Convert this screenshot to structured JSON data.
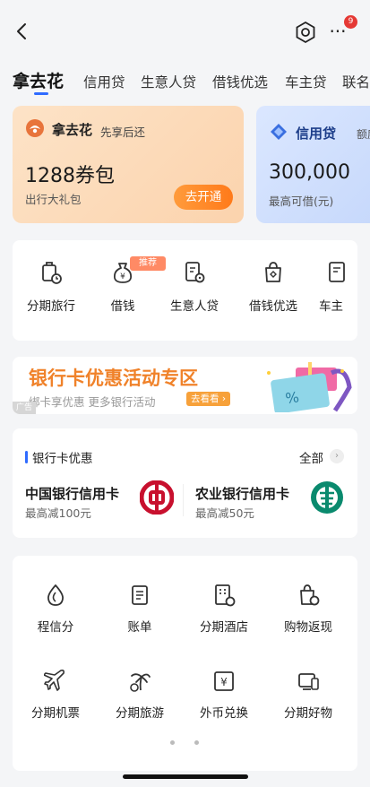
{
  "header": {
    "back_icon": "chevron-left-icon",
    "settings_icon": "hexagon-settings-icon",
    "more_icon": "more-dots-icon",
    "notification_count": "9"
  },
  "tabs": [
    {
      "label": "拿去花",
      "active": true
    },
    {
      "label": "信用贷",
      "active": false
    },
    {
      "label": "生意人贷",
      "active": false
    },
    {
      "label": "借钱优选",
      "active": false
    },
    {
      "label": "车主贷",
      "active": false
    },
    {
      "label": "联名",
      "active": false
    }
  ],
  "cards": {
    "card1": {
      "name": "拿去花",
      "subtitle": "先享后还",
      "big": "1288券包",
      "desc": "出行大礼包",
      "button": "去开通"
    },
    "card2": {
      "name": "信用贷",
      "subtitle": "额度",
      "big": "300,000",
      "desc": "最高可借(元)"
    }
  },
  "shortcuts": {
    "items": [
      {
        "label": "分期旅行",
        "icon": "luggage-icon"
      },
      {
        "label": "借钱",
        "icon": "money-bag-icon"
      },
      {
        "label": "生意人贷",
        "icon": "receipt-icon"
      },
      {
        "label": "借钱优选",
        "icon": "shopping-bag-icon"
      },
      {
        "label": "车主",
        "icon": "car-document-icon"
      }
    ],
    "recommend_tag": "推荐"
  },
  "ad": {
    "title": "银行卡优惠活动专区",
    "subtitle": "绑卡享优惠 更多银行活动",
    "button": "去看看",
    "tag": "广告"
  },
  "offers": {
    "title": "银行卡优惠",
    "all": "全部",
    "banks": [
      {
        "name": "中国银行信用卡",
        "sub": "最高减100元",
        "logo": "boc-logo-icon",
        "color": "#c8102e"
      },
      {
        "name": "农业银行信用卡",
        "sub": "最高减50元",
        "logo": "abc-logo-icon",
        "color": "#0a8a6e"
      }
    ]
  },
  "services": {
    "items": [
      {
        "label": "程信分",
        "icon": "drop-score-icon"
      },
      {
        "label": "账单",
        "icon": "bill-icon"
      },
      {
        "label": "分期酒店",
        "icon": "hotel-icon"
      },
      {
        "label": "购物返现",
        "icon": "shopping-cashback-icon"
      },
      {
        "label": "分期机票",
        "icon": "airplane-icon"
      },
      {
        "label": "分期旅游",
        "icon": "palm-tree-icon"
      },
      {
        "label": "外币兑换",
        "icon": "currency-exchange-icon"
      },
      {
        "label": "分期好物",
        "icon": "device-icon"
      }
    ]
  },
  "colors": {
    "accent": "#2f6bff",
    "orange": "#ff7a1a",
    "page_bg": "#f4f5f7"
  }
}
